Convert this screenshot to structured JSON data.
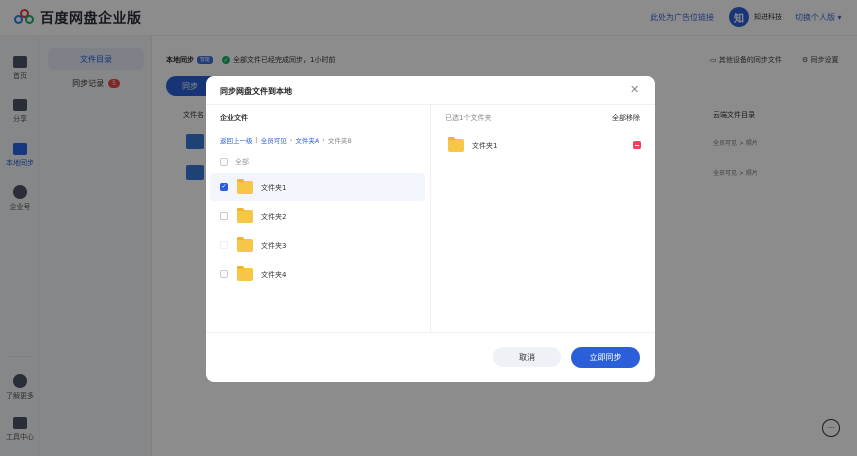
{
  "header": {
    "logo_text": "百度网盘企业版",
    "ad_link": "此处为广告位链接",
    "avatar_char": "知",
    "company": "知进科技",
    "switch_label": "切换个人版"
  },
  "leftnav": {
    "items": [
      {
        "label": "首页",
        "icon": "home-icon"
      },
      {
        "label": "分享",
        "icon": "share-icon"
      },
      {
        "label": "本地同步",
        "icon": "sync-icon",
        "active": true
      },
      {
        "label": "企业号",
        "icon": "enterprise-icon"
      }
    ],
    "bottom": [
      {
        "label": "了解更多",
        "icon": "more-icon"
      },
      {
        "label": "工具中心",
        "icon": "tools-icon"
      }
    ]
  },
  "submenu": {
    "items": [
      {
        "label": "文件目录",
        "active": true
      },
      {
        "label": "同步记录",
        "badge": "5"
      }
    ]
  },
  "main": {
    "local_title": "本地同步",
    "local_tag": "智能",
    "sync_status": "全部文件已经完成同步，1小时前",
    "other_devices": "其他设备的同步文件",
    "sync_settings": "同步设置",
    "sync_button": "同步",
    "col_file": "文件名",
    "col_cloud": "云端文件目录",
    "rows": [
      {
        "path": "全员可见 > 照片"
      },
      {
        "path": "全员可见 > 照片"
      }
    ]
  },
  "modal": {
    "title": "同步网盘文件到本地",
    "close_icon": "close-icon",
    "left_title": "企业文件",
    "breadcrumb": {
      "back": "返回上一级",
      "sep1": "|",
      "crumb1": "全员可见",
      "crumb2": "文件夹A",
      "current": "文件夹B"
    },
    "select_all": "全部",
    "files": [
      {
        "name": "文件夹1",
        "checked": true
      },
      {
        "name": "文件夹2",
        "checked": false
      },
      {
        "name": "文件夹3",
        "checked": false
      },
      {
        "name": "文件夹4",
        "checked": false
      }
    ],
    "right_count": "已选1个文件夹",
    "remove_all": "全部移除",
    "selected_files": [
      {
        "name": "文件夹1"
      }
    ],
    "cancel": "取消",
    "confirm": "立即同步"
  },
  "colors": {
    "primary": "#2b5fd9",
    "danger": "#e84557",
    "success": "#19b36b",
    "folder": "#f7c646"
  }
}
